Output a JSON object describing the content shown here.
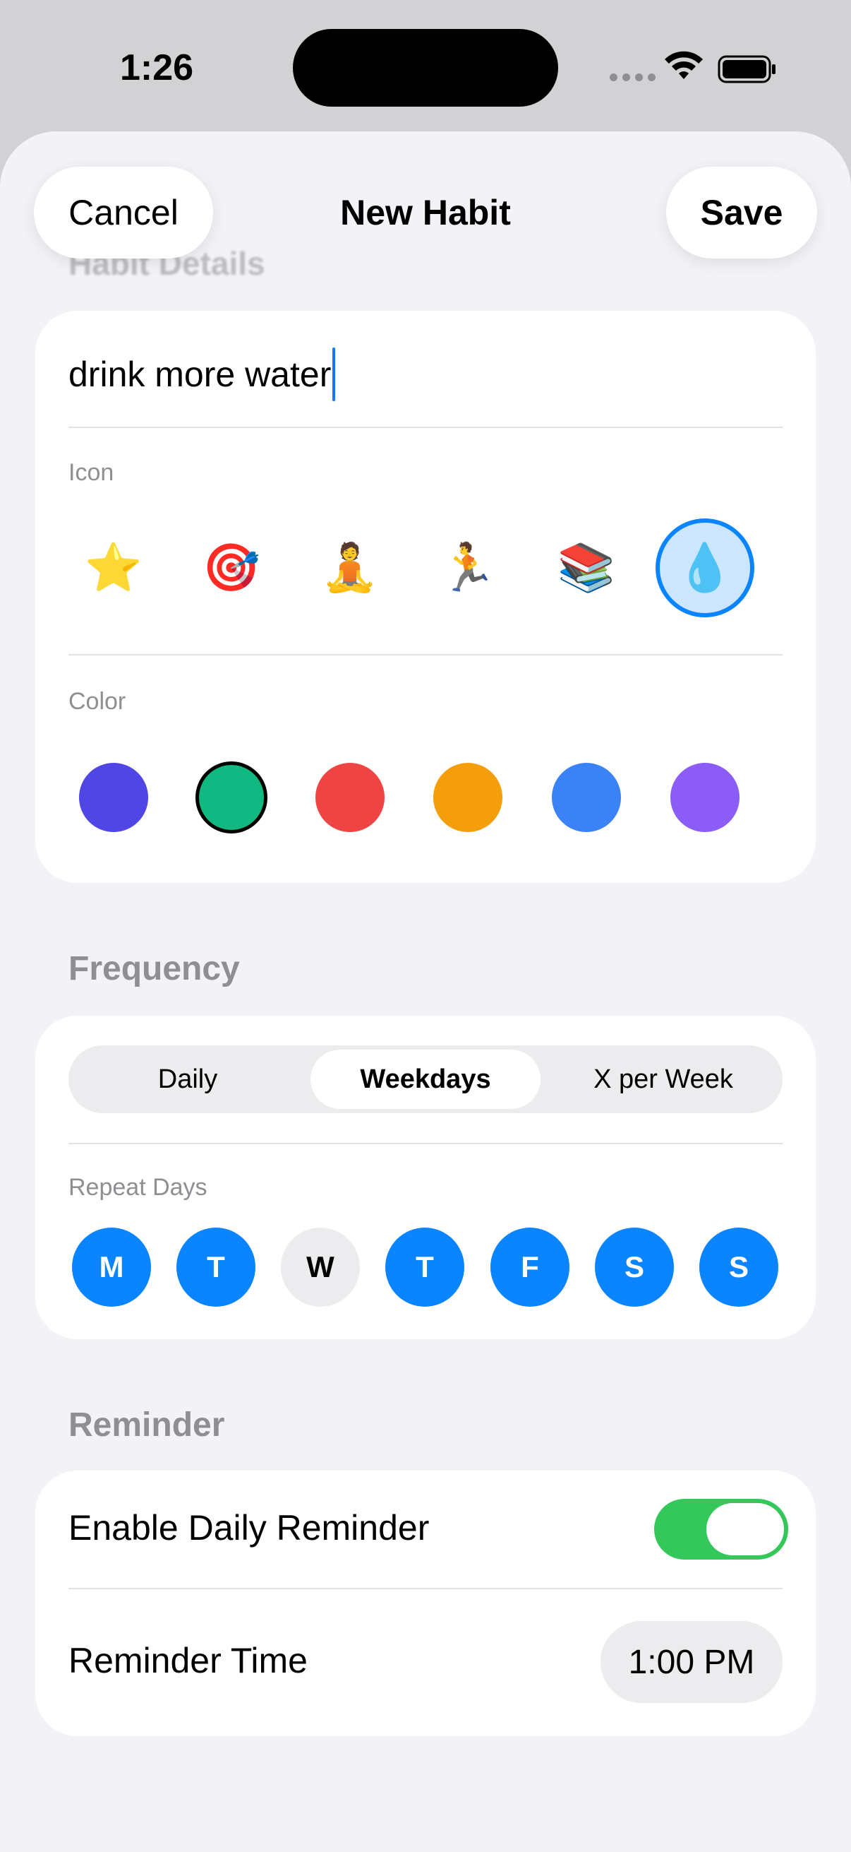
{
  "status_bar": {
    "time": "1:26"
  },
  "nav": {
    "cancel_label": "Cancel",
    "title": "New Habit",
    "save_label": "Save"
  },
  "sections": {
    "habit_details": "Habit Details",
    "frequency": "Frequency",
    "reminder": "Reminder"
  },
  "details": {
    "name_value": "drink more water",
    "icon_label": "Icon",
    "icons": [
      {
        "emoji": "⭐",
        "name": "star-icon"
      },
      {
        "emoji": "🎯",
        "name": "target-icon"
      },
      {
        "emoji": "🧘",
        "name": "meditation-icon"
      },
      {
        "emoji": "🏃",
        "name": "running-icon"
      },
      {
        "emoji": "📚",
        "name": "books-icon"
      },
      {
        "emoji": "💧",
        "name": "water-drop-icon"
      }
    ],
    "selected_icon": 5,
    "color_label": "Color",
    "colors": [
      "#5046e5",
      "#10b981",
      "#ef4444",
      "#f59e0b",
      "#3b82f6",
      "#8b5cf6"
    ],
    "selected_color": 1
  },
  "frequency": {
    "segments": [
      "Daily",
      "Weekdays",
      "X per Week"
    ],
    "selected_segment": 1,
    "repeat_days_label": "Repeat Days",
    "days": [
      {
        "letter": "M",
        "on": true
      },
      {
        "letter": "T",
        "on": true
      },
      {
        "letter": "W",
        "on": false
      },
      {
        "letter": "T",
        "on": true
      },
      {
        "letter": "F",
        "on": true
      },
      {
        "letter": "S",
        "on": true
      },
      {
        "letter": "S",
        "on": true
      }
    ]
  },
  "reminder": {
    "enable_label": "Enable Daily Reminder",
    "enabled": true,
    "time_label": "Reminder Time",
    "time_value": "1:00 PM"
  },
  "colors": {
    "accent": "#0a84ff",
    "toggle_on": "#34c759"
  }
}
